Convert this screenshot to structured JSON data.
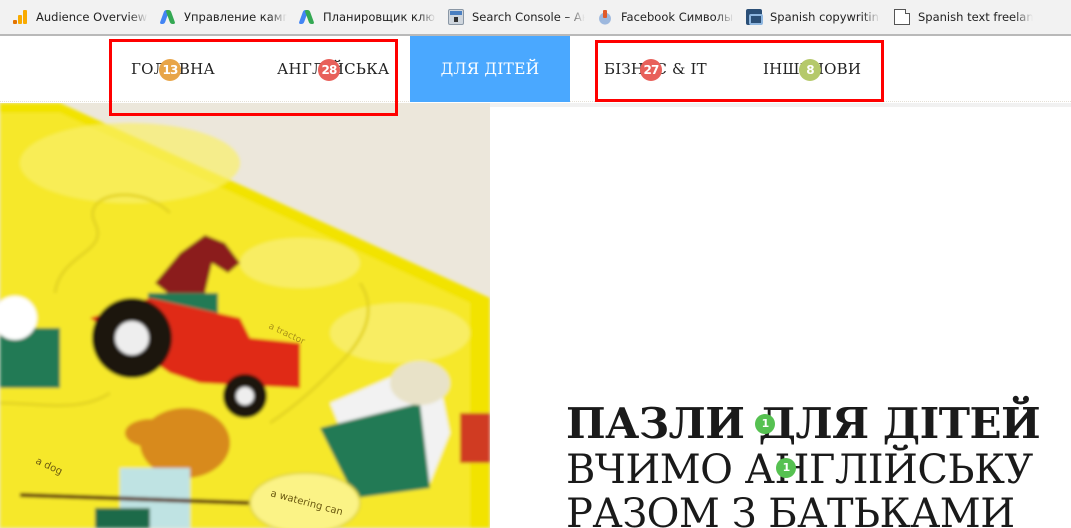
{
  "bookmarks": [
    {
      "icon": "analytics-icon",
      "label": "Audience Overview -"
    },
    {
      "icon": "google-ads-icon",
      "label": "Управление кампани"
    },
    {
      "icon": "google-ads-icon",
      "label": "Планировщик ключе"
    },
    {
      "icon": "search-console-icon",
      "label": "Search Console – Ана"
    },
    {
      "icon": "facebook-symbols-icon",
      "label": "Facebook Символы: с"
    },
    {
      "icon": "spanish-copywriting-icon",
      "label": "Spanish copywriting,"
    },
    {
      "icon": "document-icon",
      "label": "Spanish text freelance"
    }
  ],
  "nav": {
    "items": [
      {
        "label": "ГОЛОВНА",
        "badge": "13",
        "badge_color": "#e8a548"
      },
      {
        "label": "АНГЛІЙСЬКА",
        "badge": "28",
        "badge_color": "#e8605a"
      },
      {
        "label": "ДЛЯ ДІТЕЙ",
        "active": true
      },
      {
        "label": "БІЗНЕС & IT",
        "badge": "27",
        "badge_color": "#e8605a"
      },
      {
        "label": "ІНШІ НОВИ",
        "badge": "8",
        "badge_color": "#b5c96a"
      }
    ],
    "active_color": "#4aa8ff"
  },
  "hero": {
    "title": "ПАЗЛИ ДЛЯ ДІТЕЙ",
    "subtitle_line1": "ВЧИМО АНГЛІЙСЬКУ",
    "subtitle_line2": "РАЗОМ З БАТЬКАМИ",
    "title_badge": "1",
    "subtitle_badge": "1",
    "badge_color": "#56c151",
    "image_alt": "Children's farm puzzle with horse on red tractor, dog and watering can",
    "image_labels": [
      "a dog",
      "a watering can",
      "a tractor"
    ]
  },
  "annotations": {
    "highlight_color": "#ff0000"
  }
}
